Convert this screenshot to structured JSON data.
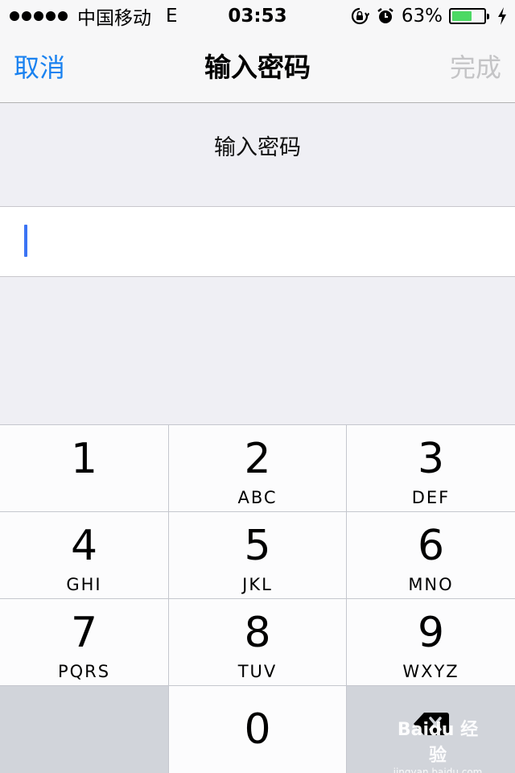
{
  "status_bar": {
    "carrier": "中国移动",
    "network": "E",
    "time": "03:53",
    "battery_percent": "63%",
    "battery_level": 0.63
  },
  "nav": {
    "cancel_label": "取消",
    "title": "输入密码",
    "done_label": "完成"
  },
  "prompt": {
    "text": "输入密码"
  },
  "password_field": {
    "value": ""
  },
  "keypad": {
    "keys": [
      {
        "digit": "1",
        "letters": ""
      },
      {
        "digit": "2",
        "letters": "ABC"
      },
      {
        "digit": "3",
        "letters": "DEF"
      },
      {
        "digit": "4",
        "letters": "GHI"
      },
      {
        "digit": "5",
        "letters": "JKL"
      },
      {
        "digit": "6",
        "letters": "MNO"
      },
      {
        "digit": "7",
        "letters": "PQRS"
      },
      {
        "digit": "8",
        "letters": "TUV"
      },
      {
        "digit": "9",
        "letters": "WXYZ"
      },
      {
        "digit": "0",
        "letters": ""
      }
    ]
  },
  "watermark": {
    "brand": "Baidu 经验",
    "url": "jingyan.baidu.com"
  },
  "colors": {
    "accent": "#1a82f0",
    "disabled": "#c4c4c6",
    "cursor": "#3b74f4",
    "battery_fill": "#4cd964"
  }
}
